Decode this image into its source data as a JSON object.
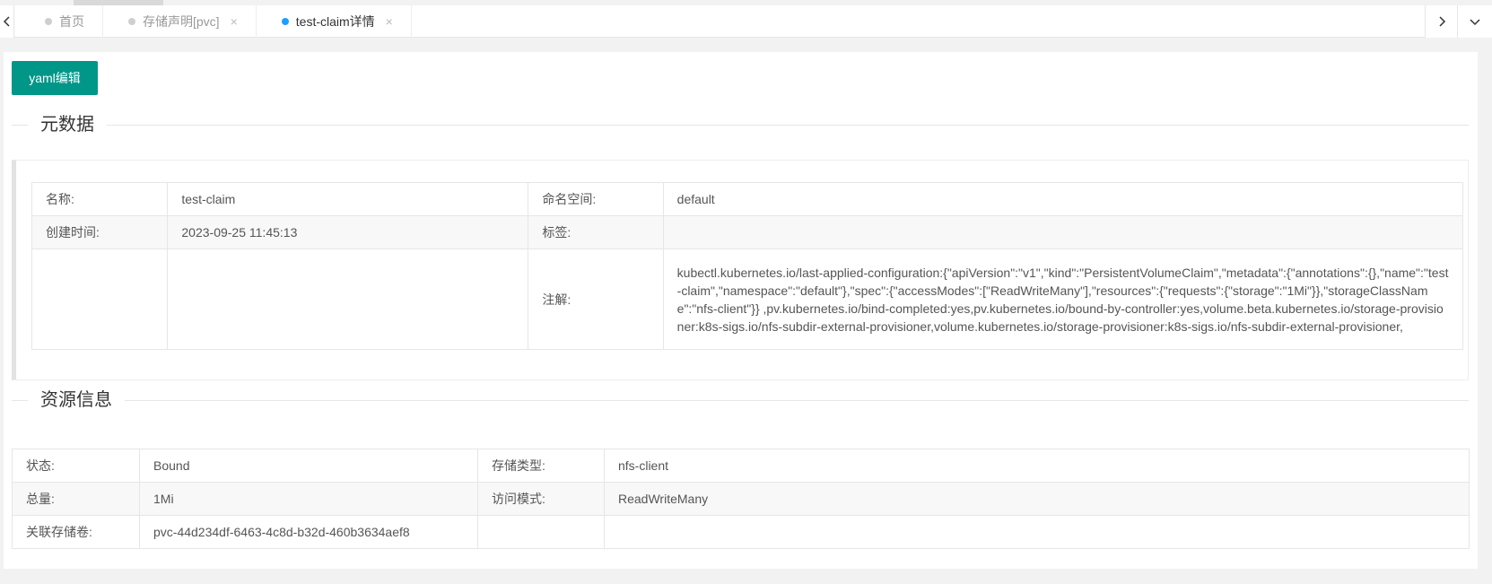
{
  "tabs": [
    {
      "label": "首页",
      "active": false,
      "closable": false
    },
    {
      "label": "存储声明[pvc]",
      "active": false,
      "closable": true
    },
    {
      "label": "test-claim详情",
      "active": true,
      "closable": true
    }
  ],
  "close_glyph": "×",
  "toolbar": {
    "yaml_edit_label": "yaml编辑"
  },
  "sections": {
    "metadata_title": "元数据",
    "resource_title": "资源信息"
  },
  "metadata": {
    "name_label": "名称:",
    "name_value": "test-claim",
    "namespace_label": "命名空间:",
    "namespace_value": "default",
    "created_label": "创建时间:",
    "created_value": "2023-09-25 11:45:13",
    "labels_label": "标签:",
    "labels_value": "",
    "annotations_label": "注解:",
    "annotations_value": "kubectl.kubernetes.io/last-applied-configuration:{\"apiVersion\":\"v1\",\"kind\":\"PersistentVolumeClaim\",\"metadata\":{\"annotations\":{},\"name\":\"test-claim\",\"namespace\":\"default\"},\"spec\":{\"accessModes\":[\"ReadWriteMany\"],\"resources\":{\"requests\":{\"storage\":\"1Mi\"}},\"storageClassName\":\"nfs-client\"}} ,pv.kubernetes.io/bind-completed:yes,pv.kubernetes.io/bound-by-controller:yes,volume.beta.kubernetes.io/storage-provisioner:k8s-sigs.io/nfs-subdir-external-provisioner,volume.kubernetes.io/storage-provisioner:k8s-sigs.io/nfs-subdir-external-provisioner,"
  },
  "resource": {
    "status_label": "状态:",
    "status_value": "Bound",
    "storage_type_label": "存储类型:",
    "storage_type_value": "nfs-client",
    "capacity_label": "总量:",
    "capacity_value": "1Mi",
    "access_mode_label": "访问模式:",
    "access_mode_value": "ReadWriteMany",
    "volume_label": "关联存储卷:",
    "volume_value": "pvc-44d234df-6463-4c8d-b32d-460b3634aef8"
  },
  "colors": {
    "primary": "#009688",
    "active_dot": "#1e9fff"
  },
  "icons": {
    "prev": "chevron-left-icon",
    "next": "chevron-right-icon",
    "more": "chevron-down-icon"
  }
}
